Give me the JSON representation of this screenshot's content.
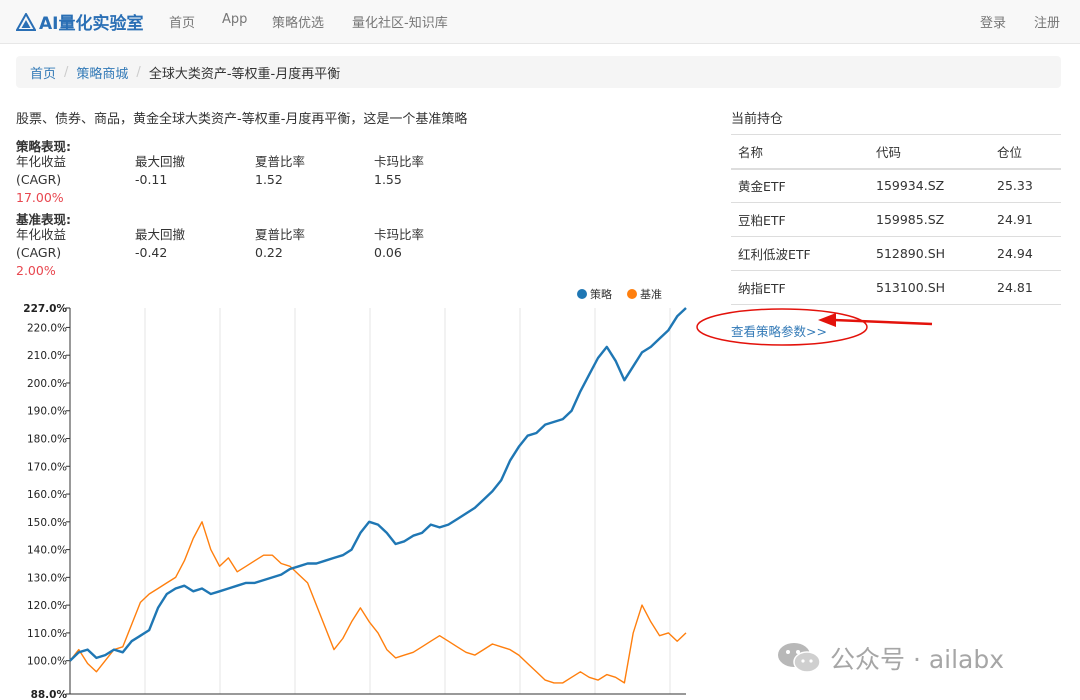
{
  "nav": {
    "brand": "AI量化实验室",
    "items": [
      "首页",
      "App",
      "策略优选",
      "量化社区-知识库"
    ],
    "login": "登录",
    "register": "注册"
  },
  "breadcrumb": {
    "home": "首页",
    "store": "策略商城",
    "current": "全球大类资产-等权重-月度再平衡"
  },
  "description": "股票、债券、商品，黄金全球大类资产-等权重-月度再平衡，这是一个基准策略",
  "strategy_perf": {
    "title": "策略表现:",
    "cagr_label_1": "年化收益",
    "cagr_label_2": "(CAGR)",
    "cagr": "17.00%",
    "mdd_label": "最大回撤",
    "mdd": "-0.11",
    "sharpe_label": "夏普比率",
    "sharpe": "1.52",
    "calmar_label": "卡玛比率",
    "calmar": "1.55"
  },
  "benchmark_perf": {
    "title": "基准表现:",
    "cagr_label_1": "年化收益",
    "cagr_label_2": "(CAGR)",
    "cagr": "2.00%",
    "mdd_label": "最大回撤",
    "mdd": "-0.42",
    "sharpe_label": "夏普比率",
    "sharpe": "0.22",
    "calmar_label": "卡玛比率",
    "calmar": "0.06"
  },
  "holdings": {
    "title": "当前持仓",
    "headers": [
      "名称",
      "代码",
      "仓位"
    ],
    "rows": [
      [
        "黄金ETF",
        "159934.SZ",
        "25.33"
      ],
      [
        "豆粕ETF",
        "159985.SZ",
        "24.91"
      ],
      [
        "红利低波ETF",
        "512890.SH",
        "24.94"
      ],
      [
        "纳指ETF",
        "513100.SH",
        "24.81"
      ]
    ]
  },
  "param_link": "查看策略参数>>",
  "watermark": "公众号 · ailabx",
  "colors": {
    "strategy": "#1f77b4",
    "benchmark": "#ff7f0e",
    "annotation": "#e3120b",
    "link": "#337ab7"
  },
  "chart_data": {
    "type": "line",
    "y_unit": "%",
    "ylim": [
      88,
      227
    ],
    "yticks": [
      "88.0%",
      "100.0%",
      "110.0%",
      "120.0%",
      "130.0%",
      "140.0%",
      "150.0%",
      "160.0%",
      "170.0%",
      "180.0%",
      "190.0%",
      "200.0%",
      "210.0%",
      "220.0%",
      "227.0%"
    ],
    "ytick_values": [
      88,
      100,
      110,
      120,
      130,
      140,
      150,
      160,
      170,
      180,
      190,
      200,
      210,
      220,
      227
    ],
    "legend_position": "top-right",
    "grid": "vertical",
    "series": [
      {
        "name": "策略",
        "values": [
          100,
          103,
          104,
          101,
          102,
          104,
          103,
          107,
          109,
          111,
          119,
          124,
          126,
          127,
          125,
          126,
          124,
          125,
          126,
          127,
          128,
          128,
          129,
          130,
          131,
          133,
          134,
          135,
          135,
          136,
          137,
          138,
          140,
          146,
          150,
          149,
          146,
          142,
          143,
          145,
          146,
          149,
          148,
          149,
          151,
          153,
          155,
          158,
          161,
          165,
          172,
          177,
          181,
          182,
          185,
          186,
          187,
          190,
          197,
          203,
          209,
          213,
          208,
          201,
          206,
          211,
          213,
          216,
          219,
          224,
          227
        ]
      },
      {
        "name": "基准",
        "values": [
          100,
          104,
          99,
          96,
          100,
          104,
          105,
          113,
          121,
          124,
          126,
          128,
          130,
          136,
          144,
          150,
          140,
          134,
          137,
          132,
          134,
          136,
          138,
          138,
          135,
          134,
          131,
          128,
          120,
          112,
          104,
          108,
          114,
          119,
          114,
          110,
          104,
          101,
          102,
          103,
          105,
          107,
          109,
          107,
          105,
          103,
          102,
          104,
          106,
          105,
          104,
          102,
          99,
          96,
          93,
          92,
          92,
          94,
          96,
          94,
          93,
          95,
          94,
          92,
          110,
          120,
          114,
          109,
          110,
          107,
          110
        ]
      }
    ]
  }
}
